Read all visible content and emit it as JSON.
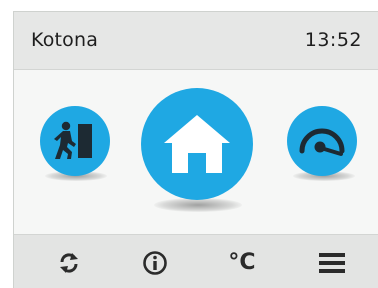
{
  "header": {
    "title": "Kotona",
    "time": "13:52"
  },
  "modes": {
    "away": {
      "icon": "away-exit-icon"
    },
    "home": {
      "icon": "home-icon",
      "active": true
    },
    "boost": {
      "icon": "speedometer-icon"
    }
  },
  "toolbar": {
    "refresh_icon": "refresh-icon",
    "info_icon": "info-icon",
    "temperature_label": "°C",
    "menu_icon": "menu-icon"
  },
  "colors": {
    "accent": "#1fa8e3",
    "header_bg": "#e6e7e6",
    "body_bg": "#f6f7f6",
    "toolbar_bg": "#e3e4e3",
    "text": "#1e1e1e"
  }
}
